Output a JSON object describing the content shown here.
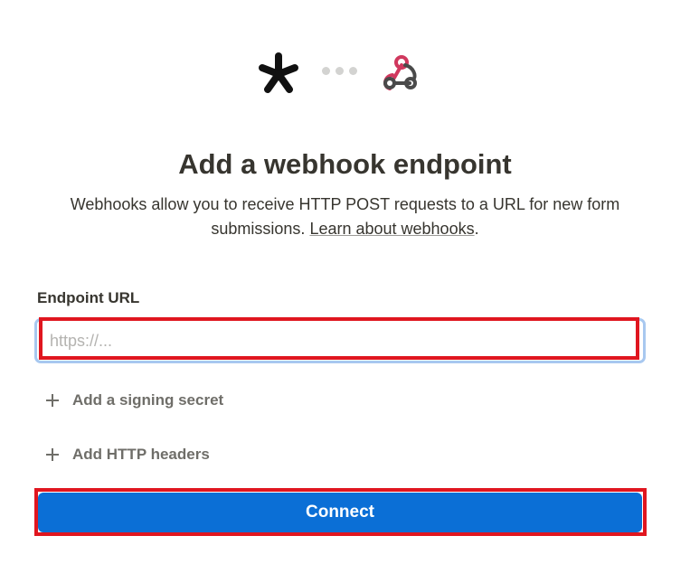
{
  "header": {
    "left_logo_icon": "asterisk-logo-icon",
    "connector_icon": "ellipsis-dots-icon",
    "right_logo_icon": "webhook-icon",
    "webhook_color": "#d0385e"
  },
  "title": "Add a webhook endpoint",
  "description": {
    "text": "Webhooks allow you to receive HTTP POST requests to a URL for new form submissions. ",
    "link_text": "Learn about webhooks",
    "suffix": "."
  },
  "form": {
    "endpoint_label": "Endpoint URL",
    "endpoint_value": "",
    "endpoint_placeholder": "https://...",
    "add_signing_secret": "Add a signing secret",
    "add_http_headers": "Add HTTP headers",
    "connect_label": "Connect"
  },
  "colors": {
    "primary": "#0b6fd6",
    "highlight": "#e0161f",
    "input_focus": "#a8c8f0"
  }
}
